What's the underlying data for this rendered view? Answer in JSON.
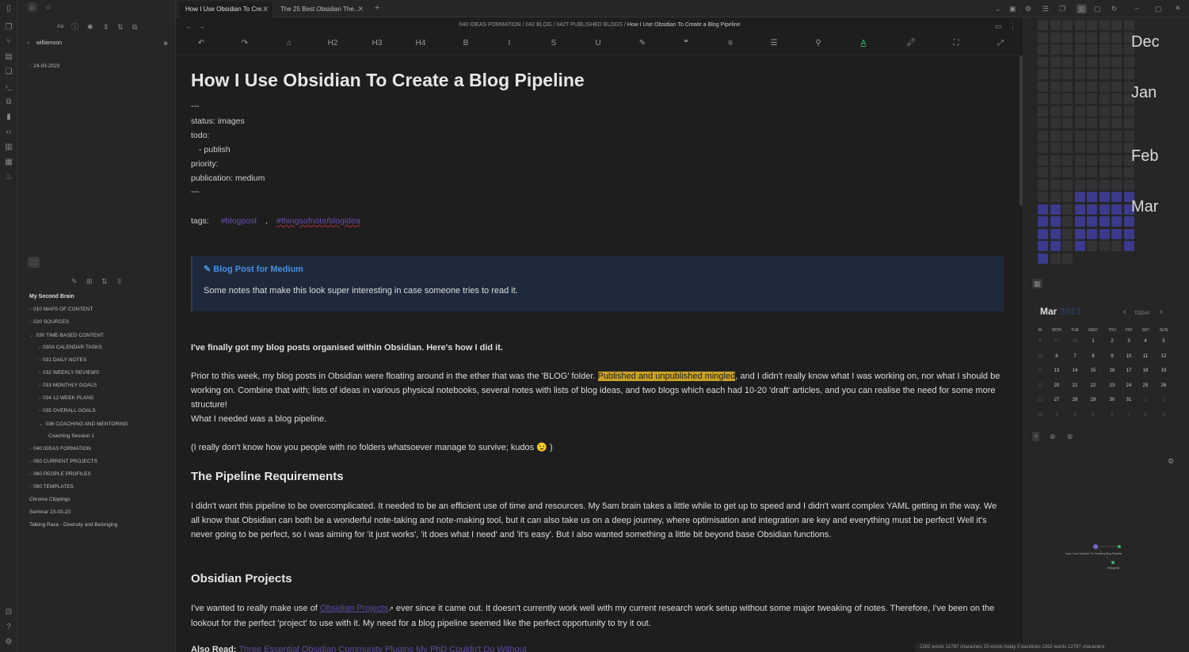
{
  "tabs": [
    {
      "label": "How I Use Obsidian To Cre..."
    },
    {
      "label": "The 25 Best Obsidian The..."
    }
  ],
  "breadcrumb": {
    "parts": [
      "040 IDEAS FORMATION",
      "042 BLOG",
      "042T PUBLISHED BLOGS"
    ],
    "current": "How I Use Obsidian To Create a Blog Pipeline"
  },
  "toolbar": {
    "icons": [
      "undo-icon",
      "redo-icon",
      "eraser-icon",
      "h2-icon",
      "h3-icon",
      "h4-icon",
      "bold-icon",
      "italic-icon",
      "strikethrough-icon",
      "underline-icon",
      "highlighter-icon",
      "quote-icon",
      "list-icon",
      "ordered-list-icon",
      "align-icon",
      "text-color-icon",
      "highlight-color-icon",
      "fullscreen-icon",
      "expand-icon"
    ],
    "labels": [
      "↶",
      "↷",
      "⌂",
      "H2",
      "H3",
      "H4",
      "B",
      "I",
      "S",
      "U",
      "✎",
      "❝",
      "≡",
      "☰",
      "⚲",
      "A",
      "🖍",
      "⛶",
      "⤢"
    ]
  },
  "search": {
    "query": "williamson",
    "result": "24-03-2023"
  },
  "vault": {
    "name": "My Second Brain",
    "items": [
      {
        "label": "010 MAPS OF CONTENT",
        "level": 0,
        "folder": true,
        "open": false
      },
      {
        "label": "020 SOURCES",
        "level": 0,
        "folder": true,
        "open": false
      },
      {
        "label": "030 TIME-BASED CONTENT",
        "level": 0,
        "folder": true,
        "open": true
      },
      {
        "label": "030A CALENDAR TASKS",
        "level": 1,
        "folder": true,
        "open": false
      },
      {
        "label": "031 DAILY NOTES",
        "level": 1,
        "folder": true,
        "open": false
      },
      {
        "label": "032 WEEKLY REVIEWS",
        "level": 1,
        "folder": true,
        "open": false
      },
      {
        "label": "033 MONTHLY GOALS",
        "level": 1,
        "folder": true,
        "open": false
      },
      {
        "label": "034 12 WEEK PLANS",
        "level": 1,
        "folder": true,
        "open": false
      },
      {
        "label": "035 OVERALL GOALS",
        "level": 1,
        "folder": true,
        "open": false
      },
      {
        "label": "036 COACHING AND MENTORING",
        "level": 1,
        "folder": true,
        "open": true
      },
      {
        "label": "Coaching Session 1",
        "level": 2,
        "folder": false,
        "open": false
      },
      {
        "label": "040 IDEAS FORMATION",
        "level": 0,
        "folder": true,
        "open": false
      },
      {
        "label": "050 CURRENT PROJECTS",
        "level": 0,
        "folder": true,
        "open": false
      },
      {
        "label": "060 PEOPLE PROFILES",
        "level": 0,
        "folder": true,
        "open": false
      },
      {
        "label": "090 TEMPLATES",
        "level": 0,
        "folder": true,
        "open": false
      },
      {
        "label": "Chrome Clippings",
        "level": 0,
        "folder": false,
        "open": false
      },
      {
        "label": "Seminar 23-03-23",
        "level": 0,
        "folder": false,
        "open": false
      },
      {
        "label": "Talking Race - Diversity and Belonging",
        "level": 0,
        "folder": false,
        "open": false
      }
    ]
  },
  "note": {
    "title": "How I Use Obsidian To Create a Blog Pipeline",
    "frontmatter": {
      "sep": "---",
      "status": "status: images",
      "todo": "todo:",
      "todo_item": "- publish",
      "priority": "priority:",
      "publication": "publication: medium",
      "tags_label": "tags:",
      "tag1": "#blogpost",
      "tag_sep": ",",
      "tag2": "#thingsofnote/blogidea"
    },
    "callout": {
      "title": "Blog Post for Medium",
      "body": "Some notes that make this look super interesting in case someone tries to read it."
    },
    "intro": "I've finally got my blog posts organised within Obsidian. Here's how I did it.",
    "p1_before": "Prior to this week, my blog posts in Obsidian were floating around in the ether that was the 'BLOG' folder. ",
    "p1_highlight": "Published and unpublished mingled",
    "p1_after": ", and I didn't really know what I was working on, nor what I should be working on. Combine that with; lists of ideas in various physical notebooks, several notes with lists of blog ideas, and two blogs which each had 10-20 'draft' articles, and you can realise the need for some more structure!",
    "p2": "What I needed was a blog pipeline.",
    "p3": "(I really don't know how you people with no folders whatsoever manage to survive; kudos 😉 )",
    "h2a": "The Pipeline Requirements",
    "p4": "I didn't want this pipeline to be overcomplicated. It needed to be an efficient use of time and resources. My 5am brain takes a little while to get up to speed and I didn't want complex YAML getting in the way. We all know that Obsidian can both be a wonderful note-taking and note-making tool, but it can also take us on a deep journey, where optimisation and integration are key and everything must be perfect! Well it's never going to be perfect, so I was aiming for 'it just works', 'it does what I need' and 'it's easy'. But I also wanted something a little bit beyond base Obsidian functions.",
    "h2b": "Obsidian Projects",
    "p5_before": "I've wanted to really make use of ",
    "p5_link": "Obsidian Projects",
    "p5_after": " ever since it came out. It doesn't currently work well with my current research work setup without some major tweaking of notes. Therefore, I've been on the lookout for the perfect 'project' to use with it. My need for a blog pipeline seemed like the perfect opportunity to try it out.",
    "also_label": "Also Read:",
    "also_link": "Three Essential Obsidian Community Plugins My PhD Couldn't Do Without"
  },
  "heatmap": {
    "months": [
      "Dec",
      "Jan",
      "Feb",
      "Mar"
    ],
    "empty_color": "#333336",
    "active_color": "#3b3a8c"
  },
  "calendar": {
    "month": "Mar",
    "year": "2023",
    "today_label": "TODAY",
    "dow": [
      "M",
      "MON",
      "TUE",
      "WED",
      "THU",
      "FRI",
      "SAT",
      "SUN"
    ],
    "weeks": [
      {
        "wk": "9",
        "days": [
          "27",
          "28",
          "1",
          "2",
          "3",
          "4",
          "5"
        ]
      },
      {
        "wk": "10",
        "days": [
          "6",
          "7",
          "8",
          "9",
          "10",
          "11",
          "12"
        ]
      },
      {
        "wk": "11",
        "days": [
          "13",
          "14",
          "15",
          "16",
          "17",
          "18",
          "19"
        ]
      },
      {
        "wk": "12",
        "days": [
          "20",
          "21",
          "22",
          "23",
          "24",
          "25",
          "26"
        ]
      },
      {
        "wk": "13",
        "days": [
          "27",
          "28",
          "29",
          "30",
          "31",
          "1",
          "2"
        ]
      },
      {
        "wk": "14",
        "days": [
          "3",
          "4",
          "5",
          "6",
          "7",
          "8",
          "9"
        ]
      }
    ]
  },
  "graph": {
    "node1": "How I Use Obsidian To Create a Blog Pipeline",
    "node2": "#blogpost"
  },
  "status": {
    "text": "2262 words 12787 characters   15 words today   0 backlinks   2262 words 12787 characters"
  }
}
